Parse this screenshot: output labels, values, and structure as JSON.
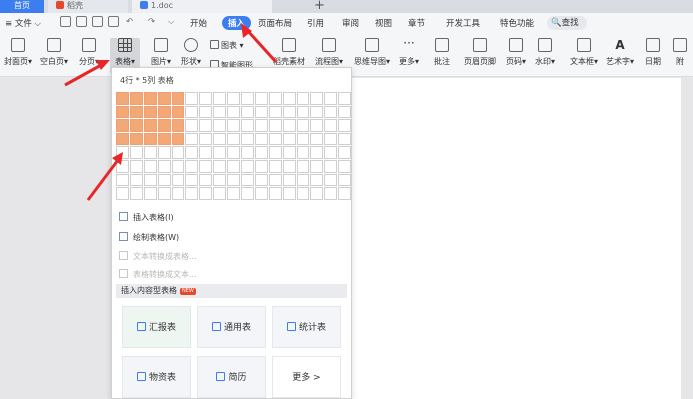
{
  "tabs": {
    "home": "首页",
    "shell": "稻壳",
    "doc": "1.doc"
  },
  "menubar": {
    "file": "文件",
    "items": [
      "开始",
      "插入",
      "页面布局",
      "引用",
      "审阅",
      "视图",
      "章节",
      "开发工具",
      "特色功能"
    ],
    "search": "查找"
  },
  "ribbon": {
    "cover": "封面页",
    "blank": "空白页",
    "pagebreak": "分页",
    "table": "表格",
    "picture": "图片",
    "shape": "形状",
    "chart": "图表",
    "smartart": "智能图形",
    "docer_material": "稻壳素材",
    "flowchart": "流程图",
    "mindmap": "思维导图",
    "more": "更多",
    "comment": "批注",
    "header_footer": "页眉页脚",
    "page_number": "页码",
    "watermark": "水印",
    "textbox": "文本框",
    "wordart": "艺术字",
    "date": "日期",
    "attach": "附"
  },
  "dropdown": {
    "grid_label": "4行 * 5列 表格",
    "grid": {
      "rows": 8,
      "cols": 17,
      "selected_rows": 4,
      "selected_cols": 5
    },
    "menu": {
      "insert_table": "插入表格(I)",
      "draw_table": "绘制表格(W)",
      "text_to_table": "文本转换成表格...",
      "table_to_text": "表格转换成文本..."
    },
    "section_title": "插入内容型表格",
    "new_badge": "NEW",
    "cards": {
      "report": "汇报表",
      "general": "通用表",
      "statistics": "统计表",
      "material": "物资表",
      "resume": "简历",
      "more": "更多 >"
    }
  },
  "colors": {
    "accent": "#3c7ef0",
    "grid_selected": "#f2a877",
    "arrow": "#e8262a"
  }
}
